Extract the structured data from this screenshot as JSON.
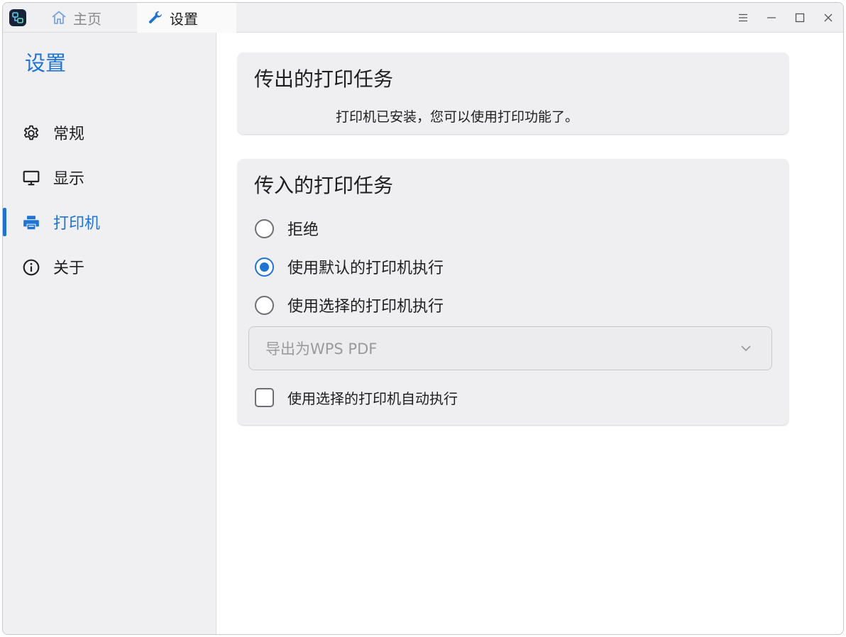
{
  "titlebar": {
    "tabs": [
      {
        "label": "主页",
        "icon": "home-icon",
        "active": false
      },
      {
        "label": "设置",
        "icon": "wrench-icon",
        "active": true
      }
    ],
    "controls": [
      "menu-icon",
      "minimize-icon",
      "maximize-icon",
      "close-icon"
    ]
  },
  "sidebar": {
    "title": "设置",
    "items": [
      {
        "label": "常规",
        "icon": "gear-icon",
        "active": false
      },
      {
        "label": "显示",
        "icon": "monitor-icon",
        "active": false
      },
      {
        "label": "打印机",
        "icon": "printer-icon",
        "active": true
      },
      {
        "label": "关于",
        "icon": "info-icon",
        "active": false
      }
    ]
  },
  "outgoing": {
    "title": "传出的打印任务",
    "status": "打印机已安装，您可以使用打印功能了。"
  },
  "incoming": {
    "title": "传入的打印任务",
    "options": [
      {
        "label": "拒绝",
        "checked": false
      },
      {
        "label": "使用默认的打印机执行",
        "checked": true
      },
      {
        "label": "使用选择的打印机执行",
        "checked": false
      }
    ],
    "printer_select": {
      "value": "导出为WPS PDF",
      "disabled": true
    },
    "auto_execute": {
      "label": "使用选择的打印机自动执行",
      "checked": false
    }
  },
  "colors": {
    "accent": "#1e74d6",
    "sidebar_bg": "#f0f0f2",
    "card_bg": "#efeff1"
  }
}
